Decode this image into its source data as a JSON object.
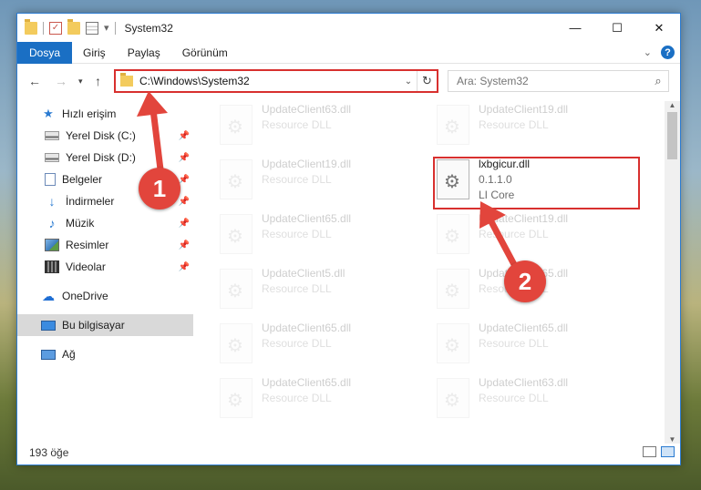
{
  "window": {
    "title": "System32"
  },
  "ribbon": {
    "tabs": [
      "Dosya",
      "Giriş",
      "Paylaş",
      "Görünüm"
    ]
  },
  "address": {
    "path": "C:\\Windows\\System32",
    "search_placeholder": "Ara: System32"
  },
  "sidebar": {
    "items": [
      {
        "label": "Hızlı erişim",
        "icon": "star-icon"
      },
      {
        "label": "Yerel Disk (C:)",
        "icon": "disk-icon",
        "pinned": true
      },
      {
        "label": "Yerel Disk (D:)",
        "icon": "disk-icon",
        "pinned": true
      },
      {
        "label": "Belgeler",
        "icon": "document-icon",
        "pinned": true
      },
      {
        "label": "İndirmeler",
        "icon": "download-icon",
        "pinned": true
      },
      {
        "label": "Müzik",
        "icon": "music-icon",
        "pinned": true
      },
      {
        "label": "Resimler",
        "icon": "pictures-icon",
        "pinned": true
      },
      {
        "label": "Videolar",
        "icon": "videos-icon",
        "pinned": true
      },
      {
        "label": "OneDrive",
        "icon": "cloud-icon"
      },
      {
        "label": "Bu bilgisayar",
        "icon": "computer-icon",
        "selected": true
      },
      {
        "label": "Ağ",
        "icon": "network-icon"
      }
    ]
  },
  "files": [
    {
      "name": "UpdateClient63.dll",
      "desc": "Resource DLL"
    },
    {
      "name": "UpdateClient19.dll",
      "desc": "Resource DLL"
    },
    {
      "name": "UpdateClient19.dll",
      "desc": "Resource DLL"
    },
    {
      "name": "lxbgicur.dll",
      "version": "0.1.1.0",
      "desc": "LI Core",
      "highlighted": true
    },
    {
      "name": "UpdateClient65.dll",
      "desc": "Resource DLL"
    },
    {
      "name": "UpdateClient19.dll",
      "desc": "Resource DLL"
    },
    {
      "name": "UpdateClient5.dll",
      "desc": "Resource DLL"
    },
    {
      "name": "UpdateClient65.dll",
      "desc": "Resource DLL"
    },
    {
      "name": "UpdateClient65.dll",
      "desc": "Resource DLL"
    },
    {
      "name": "UpdateClient65.dll",
      "desc": "Resource DLL"
    },
    {
      "name": "UpdateClient65.dll",
      "desc": "Resource DLL"
    },
    {
      "name": "UpdateClient63.dll",
      "desc": "Resource DLL"
    }
  ],
  "status": {
    "item_count": "193 öğe"
  },
  "annotations": {
    "marker1": "1",
    "marker2": "2",
    "color": "#e2453c"
  },
  "colors": {
    "accent": "#1a6fc4",
    "highlight_border": "#d8302e"
  }
}
